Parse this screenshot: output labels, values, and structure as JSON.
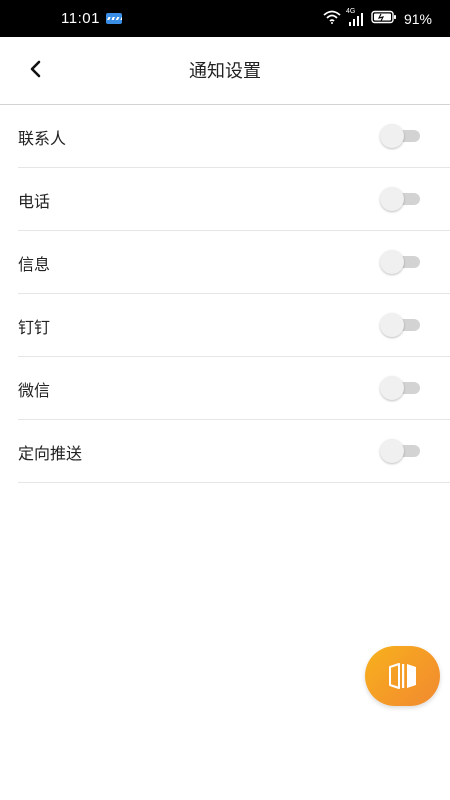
{
  "status_bar": {
    "time": "11:01",
    "notification_icon": "app-badge-icon",
    "wifi_icon": "wifi-icon",
    "network_type": "4G",
    "signal_icon": "signal-icon",
    "battery_icon": "battery-icon",
    "battery_percent": "91%"
  },
  "header": {
    "back_icon": "chevron-left-icon",
    "title": "通知设置"
  },
  "settings": {
    "items": [
      {
        "label": "联系人",
        "enabled": false
      },
      {
        "label": "电话",
        "enabled": false
      },
      {
        "label": "信息",
        "enabled": false
      },
      {
        "label": "钉钉",
        "enabled": false
      },
      {
        "label": "微信",
        "enabled": false
      },
      {
        "label": "定向推送",
        "enabled": false
      }
    ]
  },
  "floating_button": {
    "icon": "split-screen-icon"
  },
  "colors": {
    "status_bar_bg": "#000000",
    "fab_gradient_start": "#f6b21c",
    "fab_gradient_end": "#f08a30",
    "toggle_track_off": "#d3d3d3",
    "toggle_thumb_off": "#f0f0f0"
  }
}
